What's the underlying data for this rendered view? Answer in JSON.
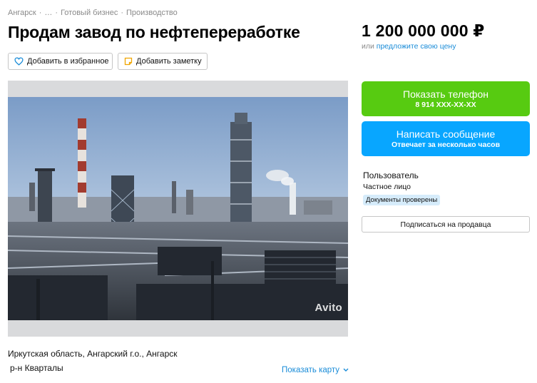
{
  "breadcrumbs": [
    "Ангарск",
    "…",
    "Готовый бизнес",
    "Производство"
  ],
  "breadcrumb_separator": "·",
  "title": "Продам завод по нефтепереработке",
  "actions": {
    "favorite_label": "Добавить в избранное",
    "note_label": "Добавить заметку"
  },
  "gallery": {
    "watermark": "Avito"
  },
  "location": {
    "address": "Иркутская область, Ангарский г.о., Ангарск",
    "district": "р-н Кварталы",
    "map_link": "Показать карту"
  },
  "price": {
    "value": "1 200 000 000 ₽",
    "alt_prefix": "или",
    "alt_link": "предложите свою цену"
  },
  "contact": {
    "phone_label": "Показать телефон",
    "phone_masked": "8 914 XXX-XX-XX",
    "message_label": "Написать сообщение",
    "message_sub": "Отвечает за несколько часов"
  },
  "seller": {
    "name": "Пользователь",
    "type": "Частное лицо",
    "badge": "Документы проверены",
    "subscribe_label": "Подписаться на продавца"
  },
  "colors": {
    "phone_button": "#57cb11",
    "message_button": "#08a6ff",
    "link": "#1a8cd8",
    "badge_bg": "#d6ecfb"
  }
}
